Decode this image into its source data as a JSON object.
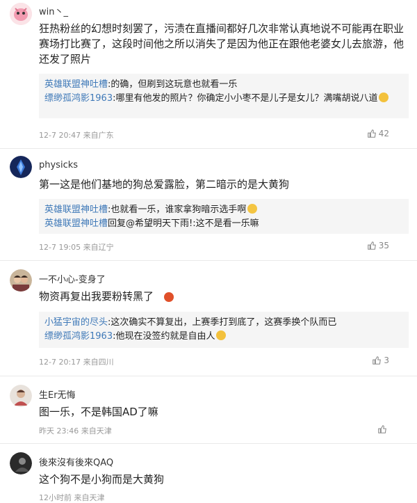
{
  "comments": [
    {
      "user": "win丶_",
      "text": "狂热粉丝的幻想时刻罢了，污渍在直播间都好几次非常认真地说不可能再在职业赛场打比赛了，这段时间他之所以消失了是因为他正在跟他老婆女儿去旅游，他还发了照片",
      "replies": [
        {
          "name": "英雄联盟神吐槽",
          "text": ":的确，但刷到这玩意也就看一乐"
        },
        {
          "name": "缥缈孤鸿影1963",
          "text": ":哪里有他发的照片？你确定小小枣不是儿子是女儿？满嘴胡说八道"
        }
      ],
      "meta": "12-7 20:47 来自广东",
      "likes": "42"
    },
    {
      "user": "physicks",
      "text": "第一这是他们基地的狗总爱露脸，第二暗示的是大黄狗",
      "replies": [
        {
          "name": "英雄联盟神吐槽",
          "text": ":也就看一乐，谁家拿狗暗示选手啊"
        },
        {
          "name": "英雄联盟神吐槽",
          "text": "回复@希望明天下雨!:这不是看一乐嘛"
        }
      ],
      "meta": "12-7 19:05 来自辽宁",
      "likes": "35"
    },
    {
      "user": "一不小心-变身了",
      "text": "物资再复出我要粉转黑了",
      "replies": [
        {
          "name": "小猛宇宙的尽头",
          "text": ":这次确实不算复出，上赛季打到底了，这赛季换个队而已"
        },
        {
          "name": "缥缈孤鸿影1963",
          "text": ":他现在没签约就是自由人"
        }
      ],
      "meta": "12-7 20:17 来自四川",
      "likes": "3"
    },
    {
      "user": "生Er无悔",
      "text": "图一乐，不是韩国AD了嘛",
      "replies": [],
      "meta": "昨天 23:46 来自天津",
      "likes": ""
    },
    {
      "user": "後來沒有後來QAQ",
      "text": "这个狗不是小狗而是大黄狗",
      "replies": [],
      "meta": "12小时前 来自天津",
      "likes": ""
    }
  ]
}
